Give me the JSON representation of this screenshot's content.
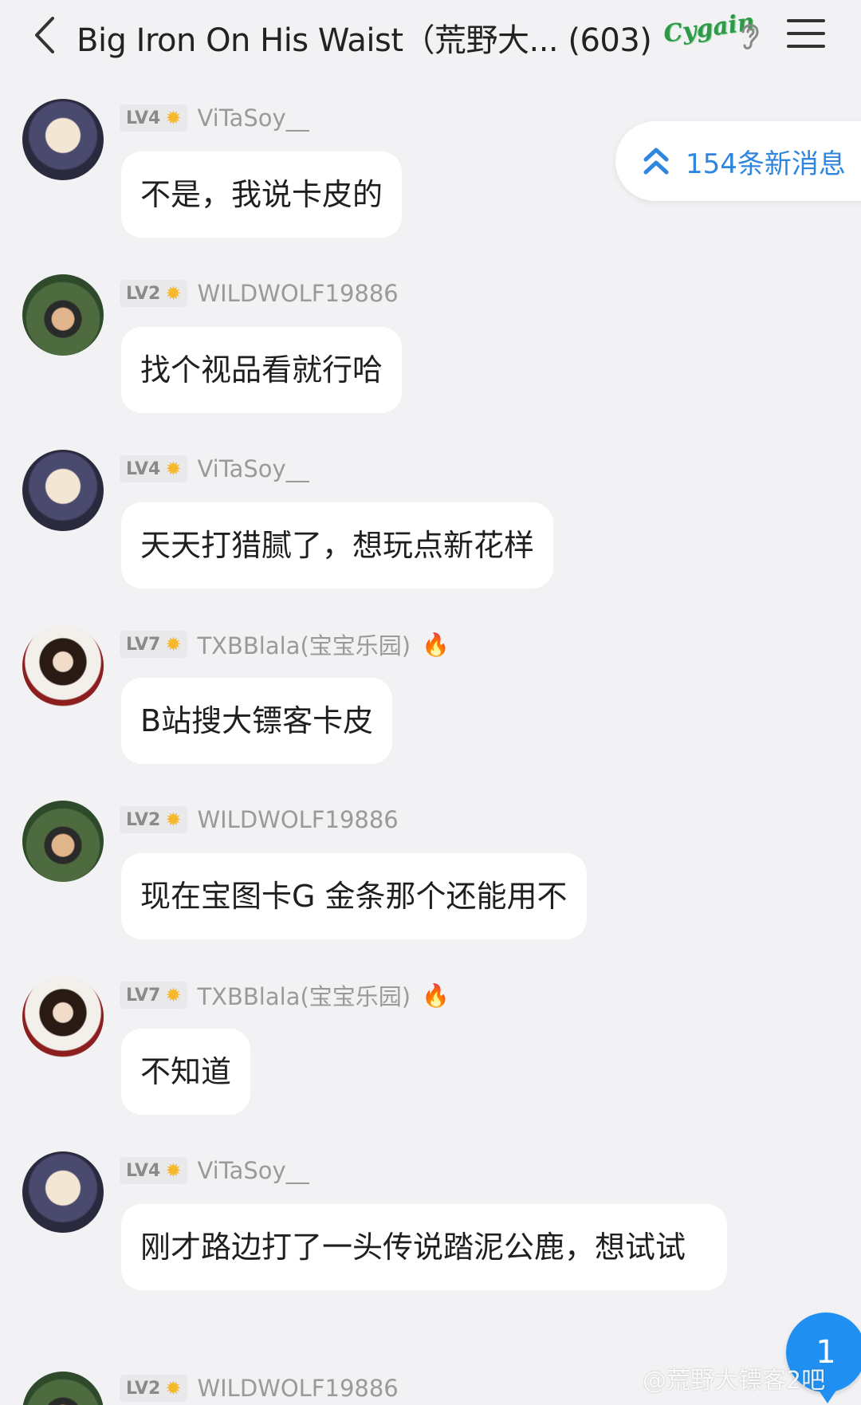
{
  "header": {
    "title": "Big Iron On His Waist（荒野大...  (603)",
    "brand_badge": "Cygain"
  },
  "new_messages": {
    "label": "154条新消息"
  },
  "messages": [
    {
      "level": "LV4",
      "user": "ViTaSoy__",
      "text": "不是，我说卡皮的",
      "avatar": "vitasoy"
    },
    {
      "level": "LV2",
      "user": "WILDWOLF19886",
      "text": "找个视品看就行哈",
      "avatar": "wildwolf"
    },
    {
      "level": "LV4",
      "user": "ViTaSoy__",
      "text": "天天打猎腻了，想玩点新花样",
      "avatar": "vitasoy"
    },
    {
      "level": "LV7",
      "user": "TXBBlala(宝宝乐园)",
      "text": "B站搜大镖客卡皮",
      "avatar": "txbb",
      "flame": true
    },
    {
      "level": "LV2",
      "user": "WILDWOLF19886",
      "text": "现在宝图卡G 金条那个还能用不",
      "avatar": "wildwolf"
    },
    {
      "level": "LV7",
      "user": "TXBBlala(宝宝乐园)",
      "text": "不知道",
      "avatar": "txbb",
      "flame": true
    },
    {
      "level": "LV4",
      "user": "ViTaSoy__",
      "text": "刚才路边打了一头传说踏泥公鹿，想试试",
      "avatar": "vitasoy"
    },
    {
      "level": "LV2",
      "user": "WILDWOLF19886",
      "text": "",
      "avatar": "wildwolf"
    }
  ],
  "unread_count": "1",
  "watermark": "@荒野大镖客2吧",
  "colors": {
    "accent": "#2e86de",
    "badge": "#1f8ff2",
    "flame": "#ff5a2a",
    "background": "#f2f2f4"
  }
}
